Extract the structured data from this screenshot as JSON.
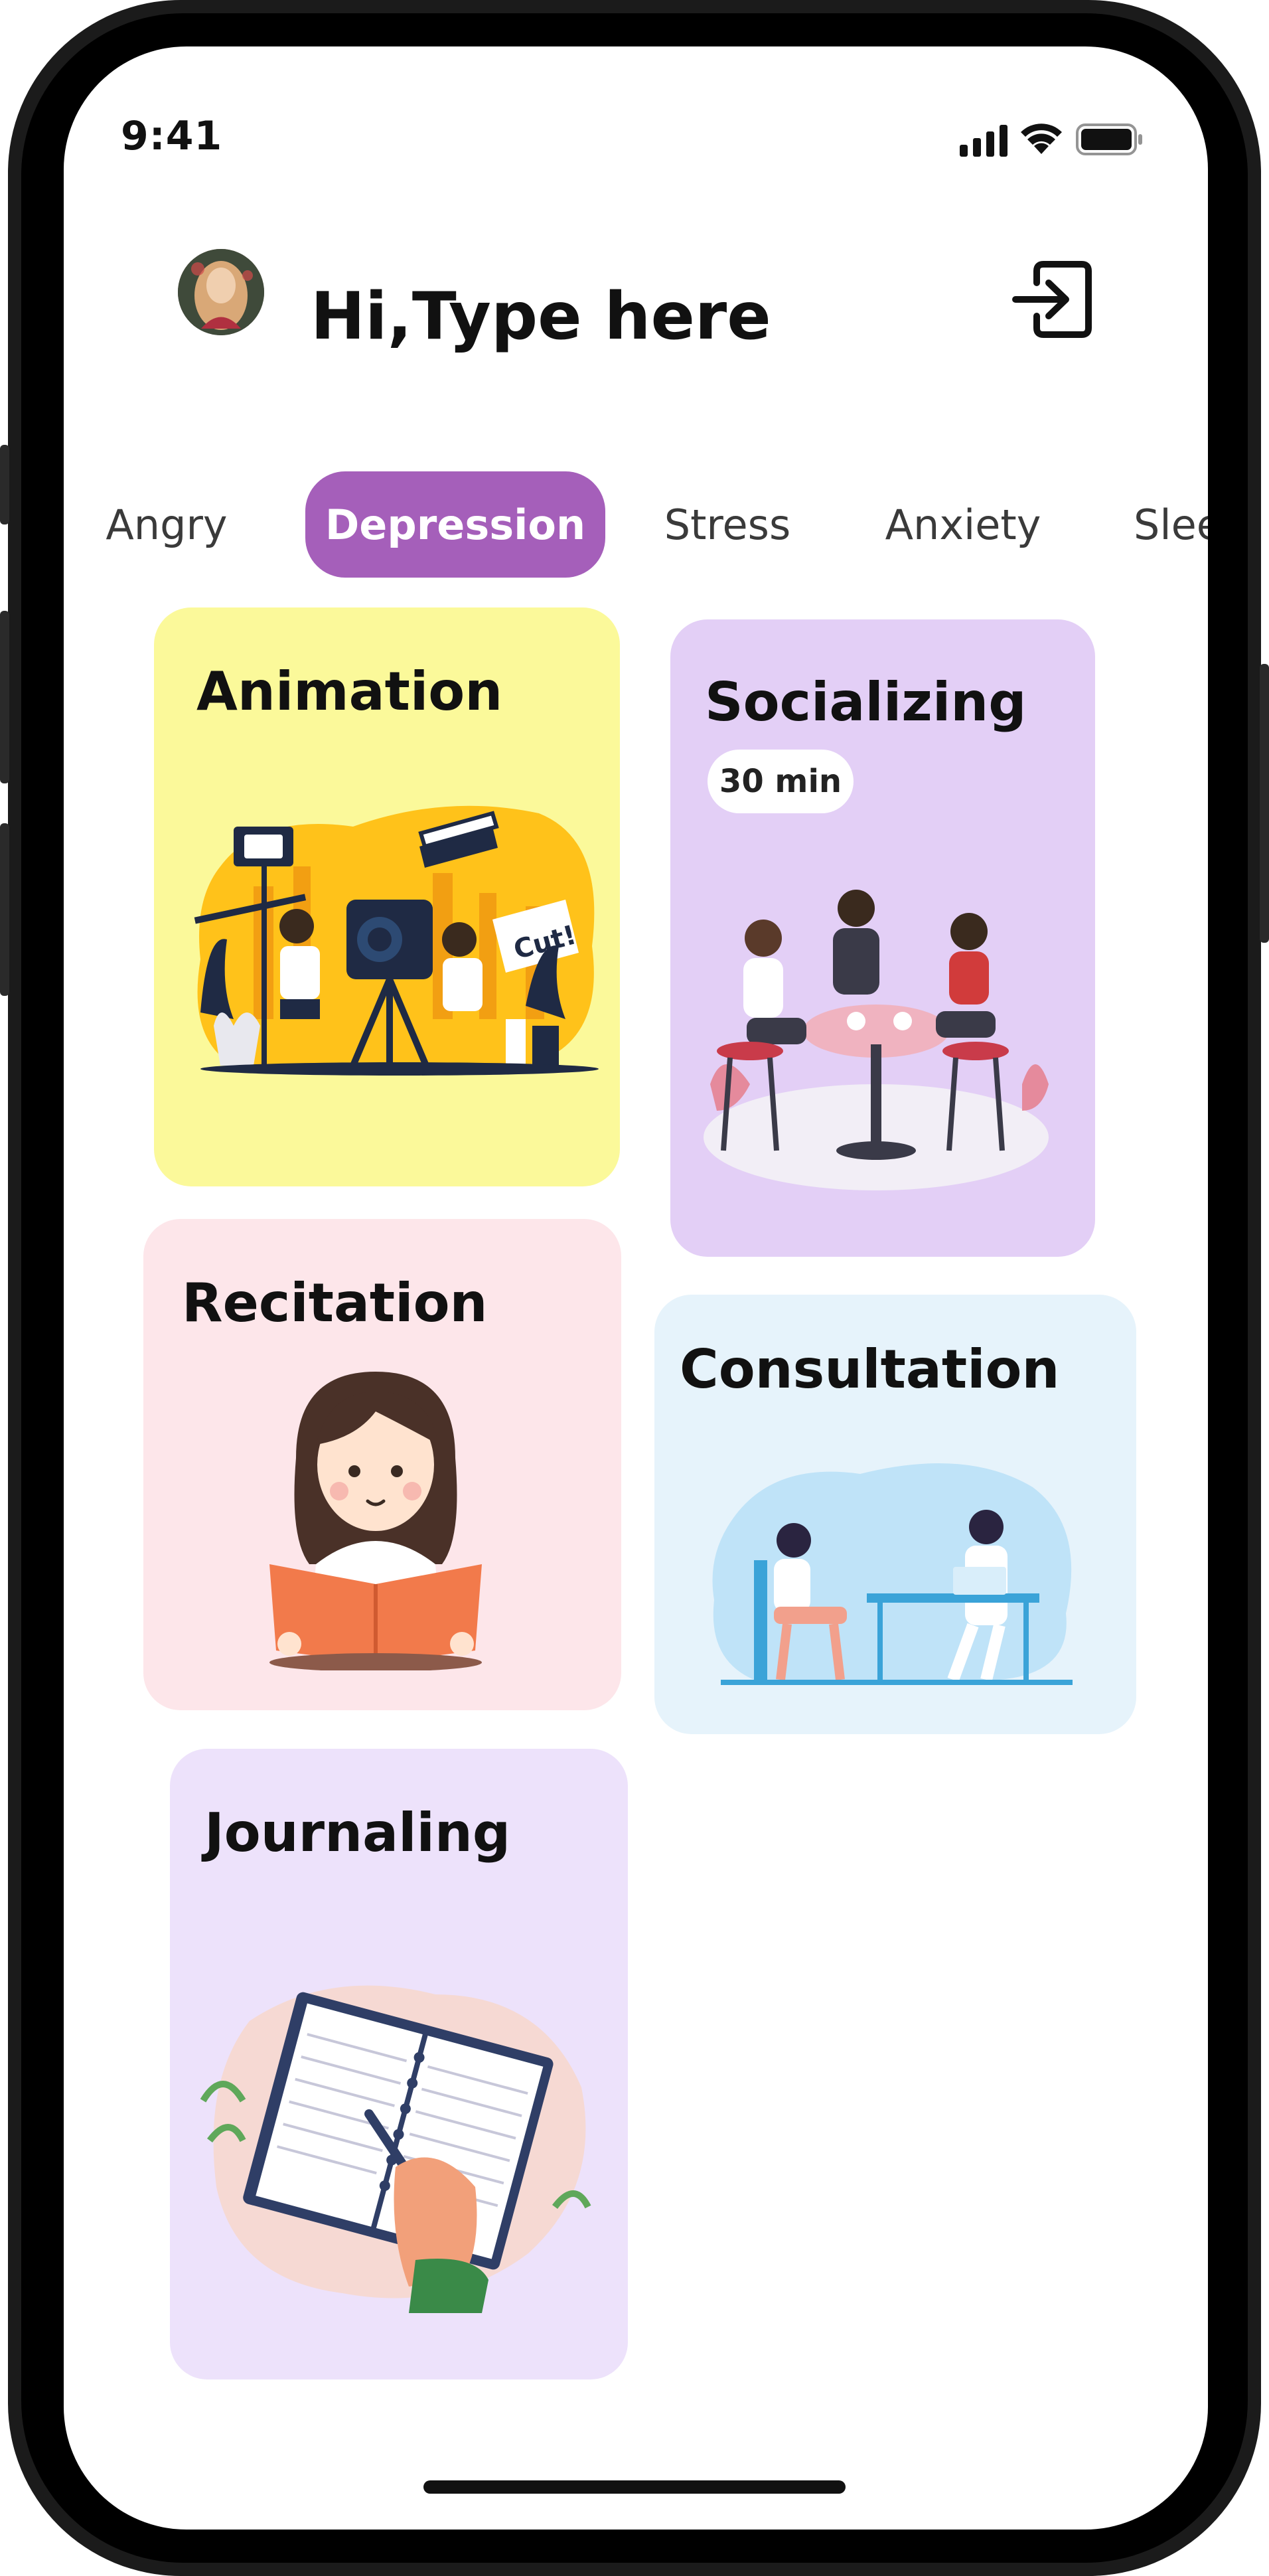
{
  "status_bar": {
    "time": "9:41"
  },
  "header": {
    "greeting": "Hi,Type here"
  },
  "tabs": [
    {
      "label": "Angry",
      "active": false
    },
    {
      "label": "Depression",
      "active": true
    },
    {
      "label": "Stress",
      "active": false
    },
    {
      "label": "Anxiety",
      "active": false
    },
    {
      "label": "Sleep",
      "active": false
    }
  ],
  "cards": {
    "animation": {
      "title": "Animation",
      "bg": "#fbf99a"
    },
    "socializing": {
      "title": "Socializing",
      "duration": "30 min",
      "bg": "#e3cff6"
    },
    "recitation": {
      "title": "Recitation",
      "bg": "#fde6ea"
    },
    "consultation": {
      "title": "Consultation",
      "bg": "#e6f3fb"
    },
    "journaling": {
      "title": "Journaling",
      "bg": "#ede2fb"
    }
  },
  "colors": {
    "accent": "#a55fba"
  }
}
